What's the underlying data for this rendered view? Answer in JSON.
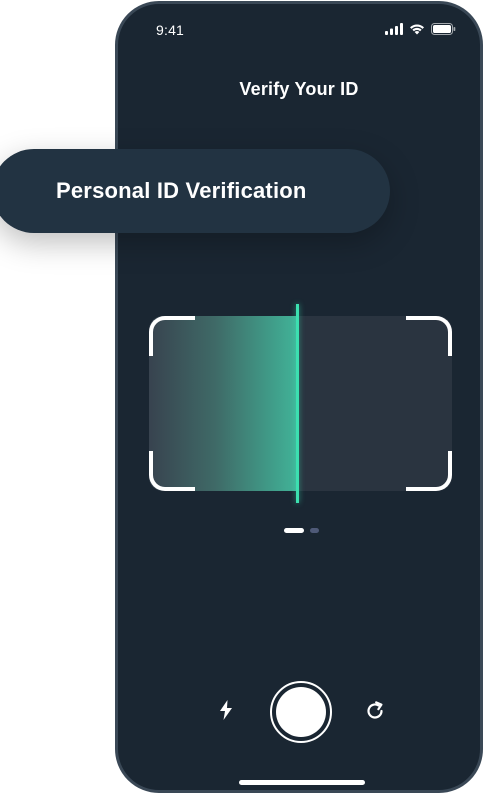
{
  "status_bar": {
    "time": "9:41",
    "icons": [
      "signal-icon",
      "wifi-icon",
      "battery-icon"
    ]
  },
  "screen": {
    "title": "Verify Your ID"
  },
  "callout": {
    "text": "Personal ID Verification"
  },
  "scanner": {
    "progress": 0.49,
    "accent_color": "#3ce0b0"
  },
  "pager": {
    "pages": 2,
    "active_index": 0
  },
  "controls": {
    "left_icon": "flash-icon",
    "center": "shutter-button",
    "right_icon": "refresh-icon"
  },
  "colors": {
    "background": "#1a2632",
    "callout_bg": "#223342",
    "accent": "#3ce0b0"
  }
}
